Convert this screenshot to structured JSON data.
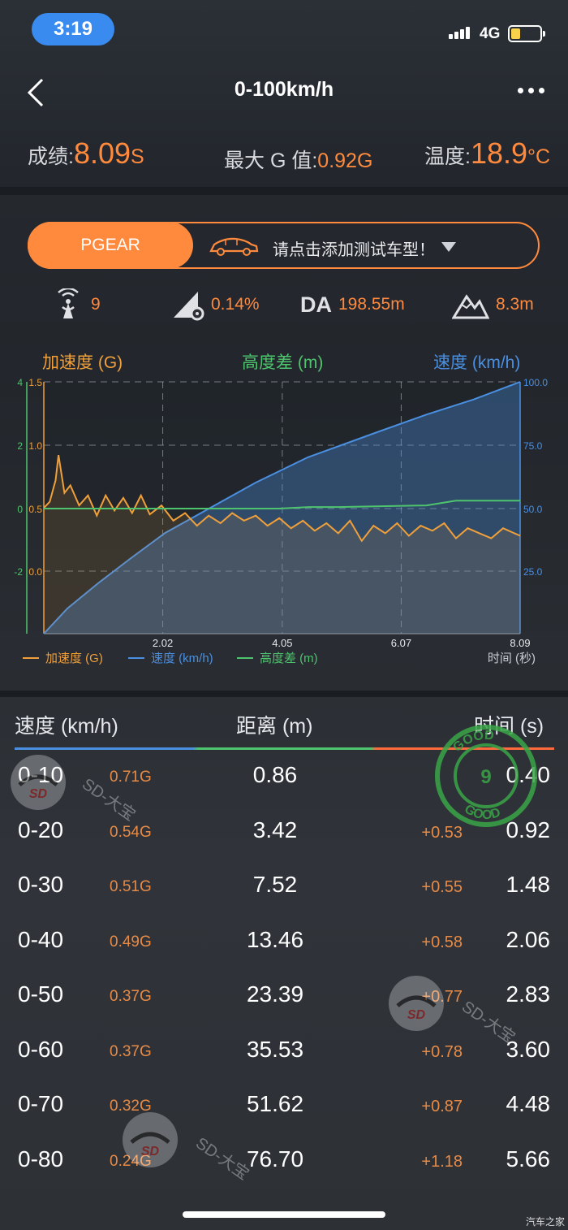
{
  "status": {
    "time": "3:19",
    "network": "4G"
  },
  "nav": {
    "title": "0-100km/h"
  },
  "summary": {
    "score_label": "成绩:",
    "score_value": "8.09",
    "score_unit": "S",
    "maxg_label": "最大 G 值:",
    "maxg_value": "0.92G",
    "temp_label": "温度:",
    "temp_value": "18.9",
    "temp_unit": "°C"
  },
  "vehicle": {
    "brand_button": "PGEAR",
    "add_car_text": "请点击添加测试车型！"
  },
  "indicators": {
    "satellites": "9",
    "slope": "0.14%",
    "da_prefix": "DA",
    "da_value": "198.55m",
    "altitude": "8.3m"
  },
  "colors": {
    "accent": "#ff8a3d",
    "speed": "#4a8fe0",
    "height": "#4fc46e",
    "accel": "#f0a03a"
  },
  "chart_data": {
    "type": "line",
    "title_left": "加速度 (G)",
    "title_mid": "高度差 (m)",
    "title_right": "速度 (km/h)",
    "x_ticks": [
      "2.02",
      "4.05",
      "6.07",
      "8.09"
    ],
    "x_axis_label": "时间 (秒)",
    "xlim": [
      0,
      8.09
    ],
    "y_left_accel_ticks": [
      "1.5",
      "1.0",
      "0.5",
      "0.0"
    ],
    "y_left_height_ticks": [
      "4",
      "2",
      "0",
      "-2"
    ],
    "y_right_speed_ticks": [
      "100.0",
      "75.0",
      "50.0",
      "25.0"
    ],
    "grid": true,
    "legend": [
      {
        "name": "加速度 (G)",
        "color": "#f0a03a"
      },
      {
        "name": "速度 (km/h)",
        "color": "#4a8fe0"
      },
      {
        "name": "高度差 (m)",
        "color": "#4fc46e"
      }
    ],
    "series": [
      {
        "name": "速度 (km/h)",
        "axis": "speed",
        "x": [
          0,
          0.4,
          0.92,
          1.48,
          2.06,
          2.83,
          3.6,
          4.48,
          5.66,
          6.5,
          7.3,
          8.09
        ],
        "values": [
          0,
          10,
          20,
          30,
          40,
          50,
          60,
          70,
          80,
          87,
          93,
          100
        ]
      },
      {
        "name": "加速度 (G)",
        "axis": "accel",
        "x": [
          0,
          0.1,
          0.2,
          0.25,
          0.35,
          0.45,
          0.6,
          0.75,
          0.9,
          1.05,
          1.2,
          1.35,
          1.5,
          1.65,
          1.8,
          2.0,
          2.2,
          2.4,
          2.6,
          2.8,
          3.0,
          3.2,
          3.4,
          3.6,
          3.8,
          4.0,
          4.2,
          4.4,
          4.6,
          4.8,
          5.0,
          5.2,
          5.4,
          5.6,
          5.8,
          6.0,
          6.2,
          6.4,
          6.6,
          6.8,
          7.0,
          7.2,
          7.4,
          7.6,
          7.8,
          8.09
        ],
        "values": [
          0.5,
          0.55,
          0.72,
          0.92,
          0.62,
          0.68,
          0.52,
          0.6,
          0.44,
          0.6,
          0.48,
          0.58,
          0.46,
          0.6,
          0.45,
          0.52,
          0.4,
          0.46,
          0.36,
          0.44,
          0.38,
          0.46,
          0.4,
          0.44,
          0.36,
          0.42,
          0.34,
          0.4,
          0.32,
          0.38,
          0.3,
          0.4,
          0.24,
          0.36,
          0.3,
          0.38,
          0.28,
          0.36,
          0.32,
          0.38,
          0.26,
          0.34,
          0.3,
          0.26,
          0.34,
          0.28
        ]
      },
      {
        "name": "高度差 (m)",
        "axis": "height",
        "x": [
          0,
          2.0,
          4.0,
          4.5,
          5.0,
          6.5,
          7.0,
          8.09
        ],
        "values": [
          0,
          0,
          0,
          0.05,
          0.05,
          0.1,
          0.25,
          0.25
        ]
      }
    ]
  },
  "table": {
    "headers": {
      "speed": "速度 (km/h)",
      "distance": "距离 (m)",
      "time": "时间 (s)"
    },
    "rows": [
      {
        "range": "0-10",
        "g": "0.71G",
        "dist": "0.86",
        "delta": "",
        "time": "0.40"
      },
      {
        "range": "0-20",
        "g": "0.54G",
        "dist": "3.42",
        "delta": "+0.53",
        "time": "0.92"
      },
      {
        "range": "0-30",
        "g": "0.51G",
        "dist": "7.52",
        "delta": "+0.55",
        "time": "1.48"
      },
      {
        "range": "0-40",
        "g": "0.49G",
        "dist": "13.46",
        "delta": "+0.58",
        "time": "2.06"
      },
      {
        "range": "0-50",
        "g": "0.37G",
        "dist": "23.39",
        "delta": "+0.77",
        "time": "2.83"
      },
      {
        "range": "0-60",
        "g": "0.37G",
        "dist": "35.53",
        "delta": "+0.78",
        "time": "3.60"
      },
      {
        "range": "0-70",
        "g": "0.32G",
        "dist": "51.62",
        "delta": "+0.87",
        "time": "4.48"
      },
      {
        "range": "0-80",
        "g": "0.24G",
        "dist": "76.70",
        "delta": "+1.18",
        "time": "5.66"
      }
    ]
  },
  "watermarks": {
    "text": "SD-大宝",
    "stamp_word": "GOOD",
    "stamp_number": "9",
    "corner_brand": "汽车之家"
  }
}
